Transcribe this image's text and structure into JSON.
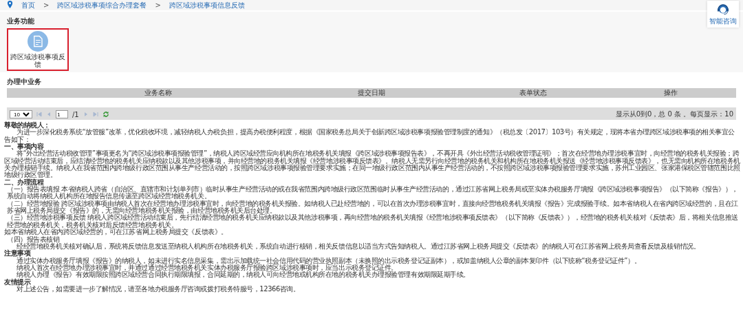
{
  "breadcrumb": {
    "separator": ">",
    "items": [
      {
        "label": "首页"
      },
      {
        "label": "跨区域涉税事项综合办理套餐"
      },
      {
        "label": "跨区域涉税事项信息反馈"
      }
    ]
  },
  "help_button": {
    "label": "智能咨询"
  },
  "functions": {
    "title": "业务功能",
    "items": [
      {
        "label": "跨区域涉税事项反馈",
        "highlighted": true
      }
    ]
  },
  "in_progress": {
    "title": "办理中业务",
    "table": {
      "columns": [
        "业务名称",
        "提交日期",
        "表单状态",
        "操作"
      ]
    },
    "pager": {
      "page_size": "10",
      "page": "1",
      "total_pages": "/1",
      "summary": "显示从0到0，总 0 条 。每页显示：10"
    }
  },
  "notice": {
    "blocks": [
      {
        "kind": "heading",
        "text": "尊敬的纳税人："
      },
      {
        "kind": "paragraph",
        "text": "为进一步深化税务系统“放管服”改革，优化税收环境，减轻纳税人办税负担，提高办税便利程度，根据《国家税务总局关于创新跨区域涉税事项报验管理制度的通知》（税总发〔2017〕103号）有关规定，现将本省办理跨区域涉税事项的相关事宜公告如下："
      },
      {
        "kind": "heading",
        "text": "一、事项内容"
      },
      {
        "kind": "paragraph",
        "text": "将“外出经营活动税收管理”事项更名为“跨区域涉税事项报验管理”，纳税人跨区域经营应向机构所在地税务机关填报《跨区域涉税事项报告表》，不再开具《外出经营活动税收管理证明》；首次在经营地办理涉税事宜时，向经营地的税务机关报验；跨区域经营活动结束后，应结清经营地的税务机关应纳税款以及其他涉税事项，并向经营地的税务机关填报《经营地涉税事项反馈表》。纳税人无需另行向经营地的税务机关和机构所在地税务机关报送《经营地涉税事项反馈表》，也无需向机构所在地税务机关办理核销手续。纳税人在我省范围内跨地级行政区范围从事生产经营活动的，按照跨区域涉税事项报验管理要求实施；在同一地级行政区范围内从事生产经营活动的，不按照跨区域涉税事项报验管理要求实施，苏州工业园区、张家港保税区管辖范围比照地级行政区管理。"
      },
      {
        "kind": "heading",
        "text": "二、办理流程"
      },
      {
        "kind": "item",
        "text": "（一）报告表填报 本省纳税人跨省（自治区、直辖市和计划单列市）临时从事生产经营活动的或在我省范围内跨地级行政区范围临时从事生产经营活动的，通过江苏省网上税务局或至实体办税服务厅填报《跨区域涉税事项报告》（以下简称《报告》），系统自动将纳税人机构所在地报告信息传递至跨区域经营地税务机关。"
      },
      {
        "kind": "item",
        "text": "（二）经营地报验 跨区域涉税事项由纳税人首次在经营地办理涉税事宜时，向经营地的税务机关报验。如纳税人已赴经营地的，可以在首次办理涉税事宜时，直接向经营地税务机关填报《报告》完成报验手续。如本省纳税人在省内跨区域经营的，且在江苏省网上税务局提交《报告》的，无需向经营地税务机关报验，由经营地税务机关后台处理。"
      },
      {
        "kind": "item",
        "text": "（三）经营地涉税事项反馈 纳税人跨区域经营活动结束后，先行结清经营地的税务机关应纳税款以及其他涉税事项，再向经营地的税务机关填报《经营地涉税事项反馈表》（以下简称《反馈表》），经营地的税务机关核对《反馈表》后，将相关信息推送经营地的税务机关，税务机关核对后反馈经营地税务机关。"
      },
      {
        "kind": "plain",
        "text": "如本省纳税人在省内跨区域经营的，可在江苏省网上税务局提交《反馈表》。"
      },
      {
        "kind": "item",
        "text": "（四）报告表核销"
      },
      {
        "kind": "paragraph",
        "text": "经经营地税务机关核对确认后，系统将反馈信息发送至纳税人机构所在地税务机关，系统自动进行核销，相关反馈信息以适当方式告知纳税人。通过江苏省网上税务局提交《反馈表》的纳税人可在江苏省网上税务局查看反馈及核销情况。"
      },
      {
        "kind": "heading",
        "text": "注意事项"
      },
      {
        "kind": "paragraph",
        "text": "通过实体办税服务厅填报《报告》的纳税人，如未进行实名信息采集，需出示加载统一社会信用代码的营业执照副本（未换照的出示税务登记证副本），或加盖纳税人公章的副本复印件（以下统称“税务登记证件”）。"
      },
      {
        "kind": "paragraph",
        "text": "纳税人首次在经营地办理涉税事宜时，并通过通过经营地税务机关实体办税服务厅报验跨区域涉税事项时，应当出示税务登记证件。"
      },
      {
        "kind": "paragraph",
        "text": "纳税人办理《报告》有效期限按照跨区域经营合同执行期限填报，合同延期的，纳税人可向经营地或机构所在地的税务机关办理报验管理有效期限延期手续。"
      },
      {
        "kind": "heading",
        "text": "友情提示"
      },
      {
        "kind": "paragraph",
        "text": "对上述公告，如需要进一步了解情况，请至各地办税服务厅咨询或拨打税务特服号，12366咨询。"
      }
    ]
  }
}
